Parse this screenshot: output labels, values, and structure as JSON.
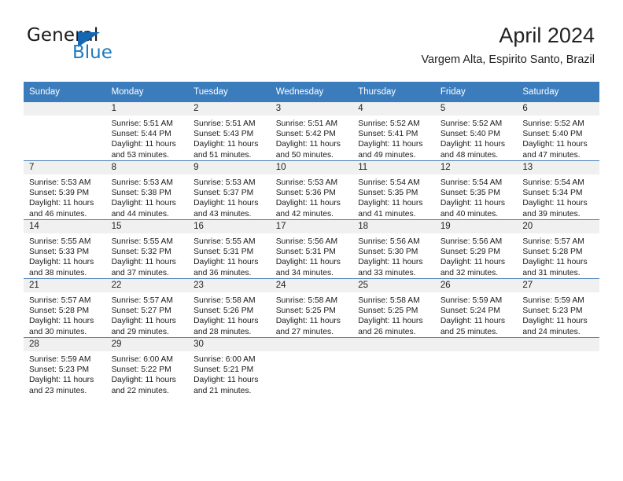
{
  "logo": {
    "word_top": "General",
    "word_bottom": "Blue",
    "triangle_icon": "blue-triangle-icon",
    "color_dark": "#1a1a1a",
    "color_blue": "#1f7ac0"
  },
  "header": {
    "month_title": "April 2024",
    "location": "Vargem Alta, Espirito Santo, Brazil"
  },
  "colors": {
    "header_band": "#3b7cbc",
    "daynum_band": "#f0f0f0",
    "week_divider": "#4a7fb5",
    "text": "#1a1a1a"
  },
  "weekdays": [
    "Sunday",
    "Monday",
    "Tuesday",
    "Wednesday",
    "Thursday",
    "Friday",
    "Saturday"
  ],
  "labels": {
    "sunrise_prefix": "Sunrise:",
    "sunset_prefix": "Sunset:",
    "daylight_prefix": "Daylight:"
  },
  "weeks": [
    [
      {
        "day": "",
        "blank": true,
        "l1": "",
        "l2": "",
        "l3": "",
        "l4": ""
      },
      {
        "day": "1",
        "l1": "Sunrise: 5:51 AM",
        "l2": "Sunset: 5:44 PM",
        "l3": "Daylight: 11 hours",
        "l4": "and 53 minutes."
      },
      {
        "day": "2",
        "l1": "Sunrise: 5:51 AM",
        "l2": "Sunset: 5:43 PM",
        "l3": "Daylight: 11 hours",
        "l4": "and 51 minutes."
      },
      {
        "day": "3",
        "l1": "Sunrise: 5:51 AM",
        "l2": "Sunset: 5:42 PM",
        "l3": "Daylight: 11 hours",
        "l4": "and 50 minutes."
      },
      {
        "day": "4",
        "l1": "Sunrise: 5:52 AM",
        "l2": "Sunset: 5:41 PM",
        "l3": "Daylight: 11 hours",
        "l4": "and 49 minutes."
      },
      {
        "day": "5",
        "l1": "Sunrise: 5:52 AM",
        "l2": "Sunset: 5:40 PM",
        "l3": "Daylight: 11 hours",
        "l4": "and 48 minutes."
      },
      {
        "day": "6",
        "l1": "Sunrise: 5:52 AM",
        "l2": "Sunset: 5:40 PM",
        "l3": "Daylight: 11 hours",
        "l4": "and 47 minutes."
      }
    ],
    [
      {
        "day": "7",
        "l1": "Sunrise: 5:53 AM",
        "l2": "Sunset: 5:39 PM",
        "l3": "Daylight: 11 hours",
        "l4": "and 46 minutes."
      },
      {
        "day": "8",
        "l1": "Sunrise: 5:53 AM",
        "l2": "Sunset: 5:38 PM",
        "l3": "Daylight: 11 hours",
        "l4": "and 44 minutes."
      },
      {
        "day": "9",
        "l1": "Sunrise: 5:53 AM",
        "l2": "Sunset: 5:37 PM",
        "l3": "Daylight: 11 hours",
        "l4": "and 43 minutes."
      },
      {
        "day": "10",
        "l1": "Sunrise: 5:53 AM",
        "l2": "Sunset: 5:36 PM",
        "l3": "Daylight: 11 hours",
        "l4": "and 42 minutes."
      },
      {
        "day": "11",
        "l1": "Sunrise: 5:54 AM",
        "l2": "Sunset: 5:35 PM",
        "l3": "Daylight: 11 hours",
        "l4": "and 41 minutes."
      },
      {
        "day": "12",
        "l1": "Sunrise: 5:54 AM",
        "l2": "Sunset: 5:35 PM",
        "l3": "Daylight: 11 hours",
        "l4": "and 40 minutes."
      },
      {
        "day": "13",
        "l1": "Sunrise: 5:54 AM",
        "l2": "Sunset: 5:34 PM",
        "l3": "Daylight: 11 hours",
        "l4": "and 39 minutes."
      }
    ],
    [
      {
        "day": "14",
        "l1": "Sunrise: 5:55 AM",
        "l2": "Sunset: 5:33 PM",
        "l3": "Daylight: 11 hours",
        "l4": "and 38 minutes."
      },
      {
        "day": "15",
        "l1": "Sunrise: 5:55 AM",
        "l2": "Sunset: 5:32 PM",
        "l3": "Daylight: 11 hours",
        "l4": "and 37 minutes."
      },
      {
        "day": "16",
        "l1": "Sunrise: 5:55 AM",
        "l2": "Sunset: 5:31 PM",
        "l3": "Daylight: 11 hours",
        "l4": "and 36 minutes."
      },
      {
        "day": "17",
        "l1": "Sunrise: 5:56 AM",
        "l2": "Sunset: 5:31 PM",
        "l3": "Daylight: 11 hours",
        "l4": "and 34 minutes."
      },
      {
        "day": "18",
        "l1": "Sunrise: 5:56 AM",
        "l2": "Sunset: 5:30 PM",
        "l3": "Daylight: 11 hours",
        "l4": "and 33 minutes."
      },
      {
        "day": "19",
        "l1": "Sunrise: 5:56 AM",
        "l2": "Sunset: 5:29 PM",
        "l3": "Daylight: 11 hours",
        "l4": "and 32 minutes."
      },
      {
        "day": "20",
        "l1": "Sunrise: 5:57 AM",
        "l2": "Sunset: 5:28 PM",
        "l3": "Daylight: 11 hours",
        "l4": "and 31 minutes."
      }
    ],
    [
      {
        "day": "21",
        "l1": "Sunrise: 5:57 AM",
        "l2": "Sunset: 5:28 PM",
        "l3": "Daylight: 11 hours",
        "l4": "and 30 minutes."
      },
      {
        "day": "22",
        "l1": "Sunrise: 5:57 AM",
        "l2": "Sunset: 5:27 PM",
        "l3": "Daylight: 11 hours",
        "l4": "and 29 minutes."
      },
      {
        "day": "23",
        "l1": "Sunrise: 5:58 AM",
        "l2": "Sunset: 5:26 PM",
        "l3": "Daylight: 11 hours",
        "l4": "and 28 minutes."
      },
      {
        "day": "24",
        "l1": "Sunrise: 5:58 AM",
        "l2": "Sunset: 5:25 PM",
        "l3": "Daylight: 11 hours",
        "l4": "and 27 minutes."
      },
      {
        "day": "25",
        "l1": "Sunrise: 5:58 AM",
        "l2": "Sunset: 5:25 PM",
        "l3": "Daylight: 11 hours",
        "l4": "and 26 minutes."
      },
      {
        "day": "26",
        "l1": "Sunrise: 5:59 AM",
        "l2": "Sunset: 5:24 PM",
        "l3": "Daylight: 11 hours",
        "l4": "and 25 minutes."
      },
      {
        "day": "27",
        "l1": "Sunrise: 5:59 AM",
        "l2": "Sunset: 5:23 PM",
        "l3": "Daylight: 11 hours",
        "l4": "and 24 minutes."
      }
    ],
    [
      {
        "day": "28",
        "l1": "Sunrise: 5:59 AM",
        "l2": "Sunset: 5:23 PM",
        "l3": "Daylight: 11 hours",
        "l4": "and 23 minutes."
      },
      {
        "day": "29",
        "l1": "Sunrise: 6:00 AM",
        "l2": "Sunset: 5:22 PM",
        "l3": "Daylight: 11 hours",
        "l4": "and 22 minutes."
      },
      {
        "day": "30",
        "l1": "Sunrise: 6:00 AM",
        "l2": "Sunset: 5:21 PM",
        "l3": "Daylight: 11 hours",
        "l4": "and 21 minutes."
      },
      {
        "day": "",
        "blank": true,
        "l1": "",
        "l2": "",
        "l3": "",
        "l4": ""
      },
      {
        "day": "",
        "blank": true,
        "l1": "",
        "l2": "",
        "l3": "",
        "l4": ""
      },
      {
        "day": "",
        "blank": true,
        "l1": "",
        "l2": "",
        "l3": "",
        "l4": ""
      },
      {
        "day": "",
        "blank": true,
        "l1": "",
        "l2": "",
        "l3": "",
        "l4": ""
      }
    ]
  ]
}
